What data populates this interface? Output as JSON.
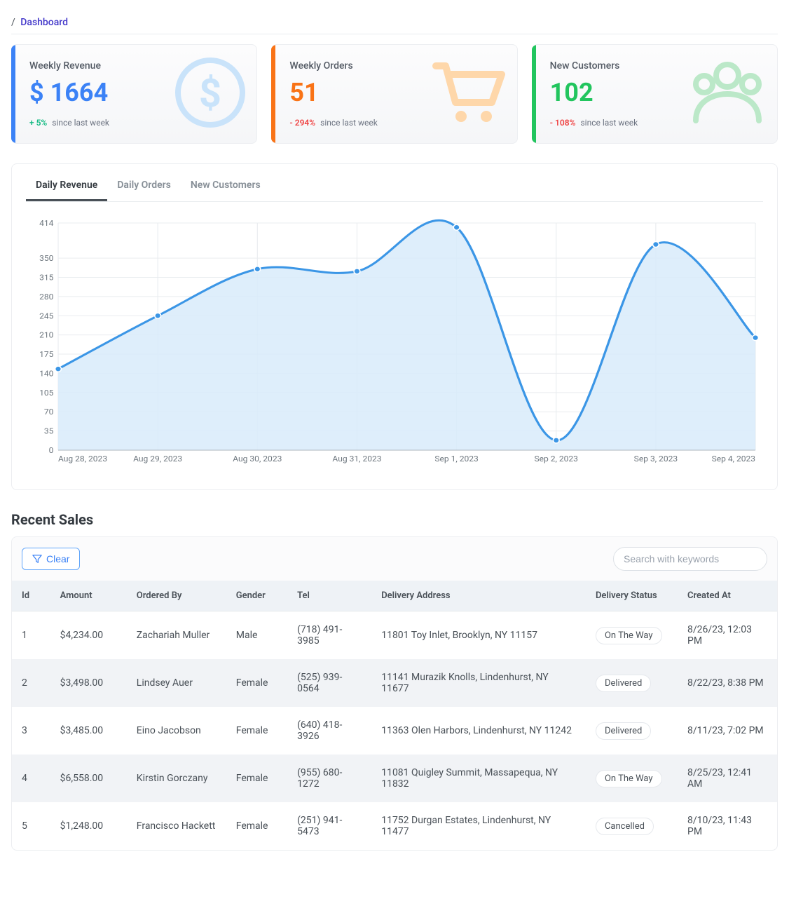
{
  "breadcrumb": {
    "slash": "/",
    "link": "Dashboard"
  },
  "stats": {
    "revenue": {
      "title": "Weekly Revenue",
      "value": "$ 1664",
      "change_pct": "+ 5%",
      "change_label": "since last week"
    },
    "orders": {
      "title": "Weekly Orders",
      "value": "51",
      "change_pct": "- 294%",
      "change_label": "since last week"
    },
    "customers": {
      "title": "New Customers",
      "value": "102",
      "change_pct": "- 108%",
      "change_label": "since last week"
    }
  },
  "chart_tabs": {
    "daily_revenue": "Daily Revenue",
    "daily_orders": "Daily Orders",
    "new_customers": "New Customers"
  },
  "chart_data": {
    "type": "area",
    "x_labels": [
      "Aug 28, 2023",
      "Aug 29, 2023",
      "Aug 30, 2023",
      "Aug 31, 2023",
      "Sep 1, 2023",
      "Sep 2, 2023",
      "Sep 3, 2023",
      "Sep 4, 2023"
    ],
    "y_ticks": [
      0,
      35,
      70,
      105,
      140,
      175,
      210,
      245,
      280,
      315,
      350,
      414
    ],
    "ylim": [
      0,
      414
    ],
    "series": [
      {
        "name": "Daily Revenue",
        "values": [
          148,
          245,
          330,
          326,
          406,
          18,
          375,
          205
        ]
      }
    ],
    "colors": {
      "line": "#3B96E6",
      "fill": "#d8ebfa",
      "grid": "#e9ecef",
      "axis_text": "#6c757d"
    }
  },
  "recent_sales": {
    "title": "Recent Sales",
    "clear_label": "Clear",
    "search_placeholder": "Search with keywords",
    "columns": [
      "Id",
      "Amount",
      "Ordered By",
      "Gender",
      "Tel",
      "Delivery Address",
      "Delivery Status",
      "Created At"
    ],
    "rows": [
      {
        "id": "1",
        "amount": "$4,234.00",
        "ordered_by": "Zachariah Muller",
        "gender": "Male",
        "tel": "(718) 491-3985",
        "address": "11801 Toy Inlet, Brooklyn, NY 11157",
        "status": "On The Way",
        "created": "8/26/23, 12:03 PM"
      },
      {
        "id": "2",
        "amount": "$3,498.00",
        "ordered_by": "Lindsey Auer",
        "gender": "Female",
        "tel": "(525) 939-0564",
        "address": "11141 Murazik Knolls, Lindenhurst, NY 11677",
        "status": "Delivered",
        "created": "8/22/23, 8:38 PM"
      },
      {
        "id": "3",
        "amount": "$3,485.00",
        "ordered_by": "Eino Jacobson",
        "gender": "Female",
        "tel": "(640) 418-3926",
        "address": "11363 Olen Harbors, Lindenhurst, NY 11242",
        "status": "Delivered",
        "created": "8/11/23, 7:02 PM"
      },
      {
        "id": "4",
        "amount": "$6,558.00",
        "ordered_by": "Kirstin Gorczany",
        "gender": "Female",
        "tel": "(955) 680-1272",
        "address": "11081 Quigley Summit, Massapequa, NY 11832",
        "status": "On The Way",
        "created": "8/25/23, 12:41 AM"
      },
      {
        "id": "5",
        "amount": "$1,248.00",
        "ordered_by": "Francisco Hackett",
        "gender": "Female",
        "tel": "(251) 941-5473",
        "address": "11752 Durgan Estates, Lindenhurst, NY 11477",
        "status": "Cancelled",
        "created": "8/10/23, 11:43 PM"
      }
    ]
  }
}
